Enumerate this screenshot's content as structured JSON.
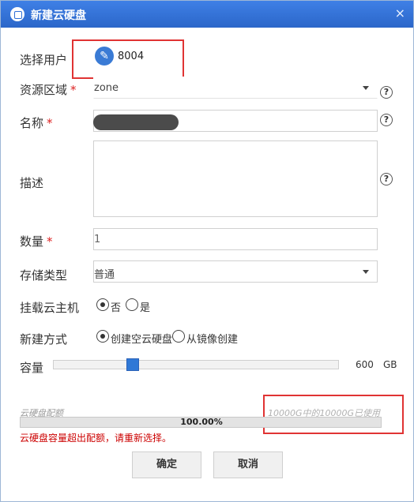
{
  "dialog": {
    "title": "新建云硬盘",
    "close_glyph": "×"
  },
  "form": {
    "user": {
      "label": "选择用户",
      "id": "8004"
    },
    "region": {
      "label": "资源区域",
      "required": "*",
      "value": "zone"
    },
    "name": {
      "label": "名称",
      "required": "*"
    },
    "description": {
      "label": "描述"
    },
    "quantity": {
      "label": "数量",
      "required": "*",
      "value": "1"
    },
    "storage_type": {
      "label": "存储类型",
      "value": "普通"
    },
    "attach_vm": {
      "label": "挂载云主机",
      "options": [
        {
          "label": "否",
          "selected": true
        },
        {
          "label": "是",
          "selected": false
        }
      ]
    },
    "create_method": {
      "label": "新建方式",
      "options": [
        {
          "label": "创建空云硬盘",
          "selected": true
        },
        {
          "label": "从镜像创建",
          "selected": false
        }
      ]
    },
    "capacity": {
      "label": "容量",
      "value": "600",
      "unit": "GB",
      "fraction": 0.27
    }
  },
  "quota": {
    "label": "云硬盘配额",
    "usage_text": "10000G中的10000G已使用",
    "progress_text": "100.00%",
    "progress_fraction": 1.0,
    "error": "云硬盘容量超出配额，请重新选择。"
  },
  "buttons": {
    "confirm": "确定",
    "cancel": "取消"
  },
  "help_glyph": "?",
  "colors": {
    "title_bar": "#2f6fd6",
    "required": "#dd2222",
    "error": "#cc0000",
    "highlight_box": "#e03333"
  }
}
